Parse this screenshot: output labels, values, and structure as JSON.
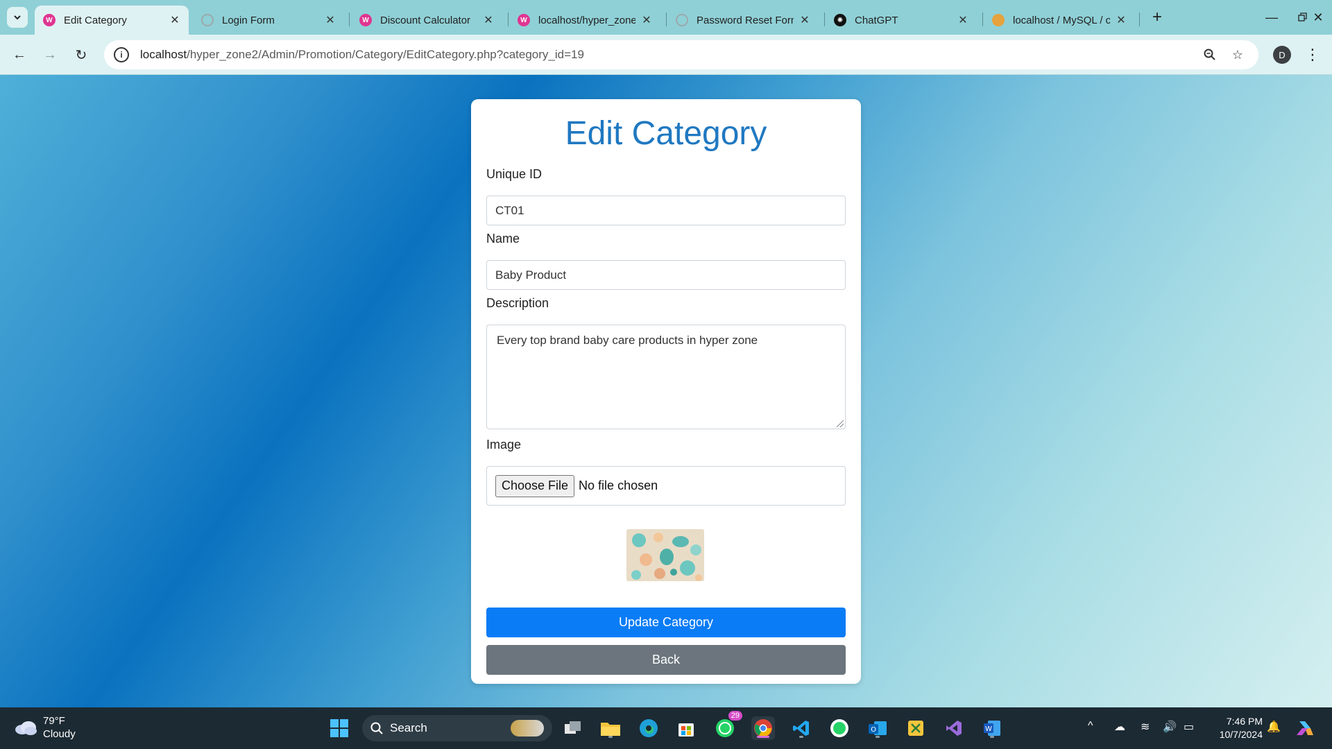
{
  "browser": {
    "tabs": [
      {
        "label": "Edit Category",
        "favicon": "wamp-icon",
        "active": true
      },
      {
        "label": "Login Form",
        "favicon": "globe-icon",
        "active": false
      },
      {
        "label": "Discount Calculator",
        "favicon": "wamp-icon",
        "active": false
      },
      {
        "label": "localhost/hyper_zone",
        "favicon": "wamp-icon",
        "active": false
      },
      {
        "label": "Password Reset Form",
        "favicon": "globe-icon",
        "active": false
      },
      {
        "label": "ChatGPT",
        "favicon": "openai-icon",
        "active": false
      },
      {
        "label": "localhost / MySQL / c",
        "favicon": "phpmyadmin-icon",
        "active": false
      }
    ],
    "url_host": "localhost",
    "url_path": "/hyper_zone2/Admin/Promotion/Category/EditCategory.php?category_id=19",
    "profile_initial": "D"
  },
  "form": {
    "title": "Edit Category",
    "unique_id_label": "Unique ID",
    "unique_id_value": "CT01",
    "name_label": "Name",
    "name_value": "Baby Product",
    "description_label": "Description",
    "description_value": "Every top brand baby care products in hyper zone",
    "image_label": "Image",
    "choose_file_label": "Choose File",
    "no_file_text": "No file chosen",
    "update_button": "Update Category",
    "back_button": "Back"
  },
  "taskbar": {
    "weather_temp": "79°F",
    "weather_desc": "Cloudy",
    "search_label": "Search",
    "whatsapp_badge": "29",
    "time": "7:46 PM",
    "date": "10/7/2024"
  },
  "colors": {
    "title": "#1f78c1",
    "primary_button": "#0a7cf5",
    "secondary_button": "#6c757d"
  }
}
